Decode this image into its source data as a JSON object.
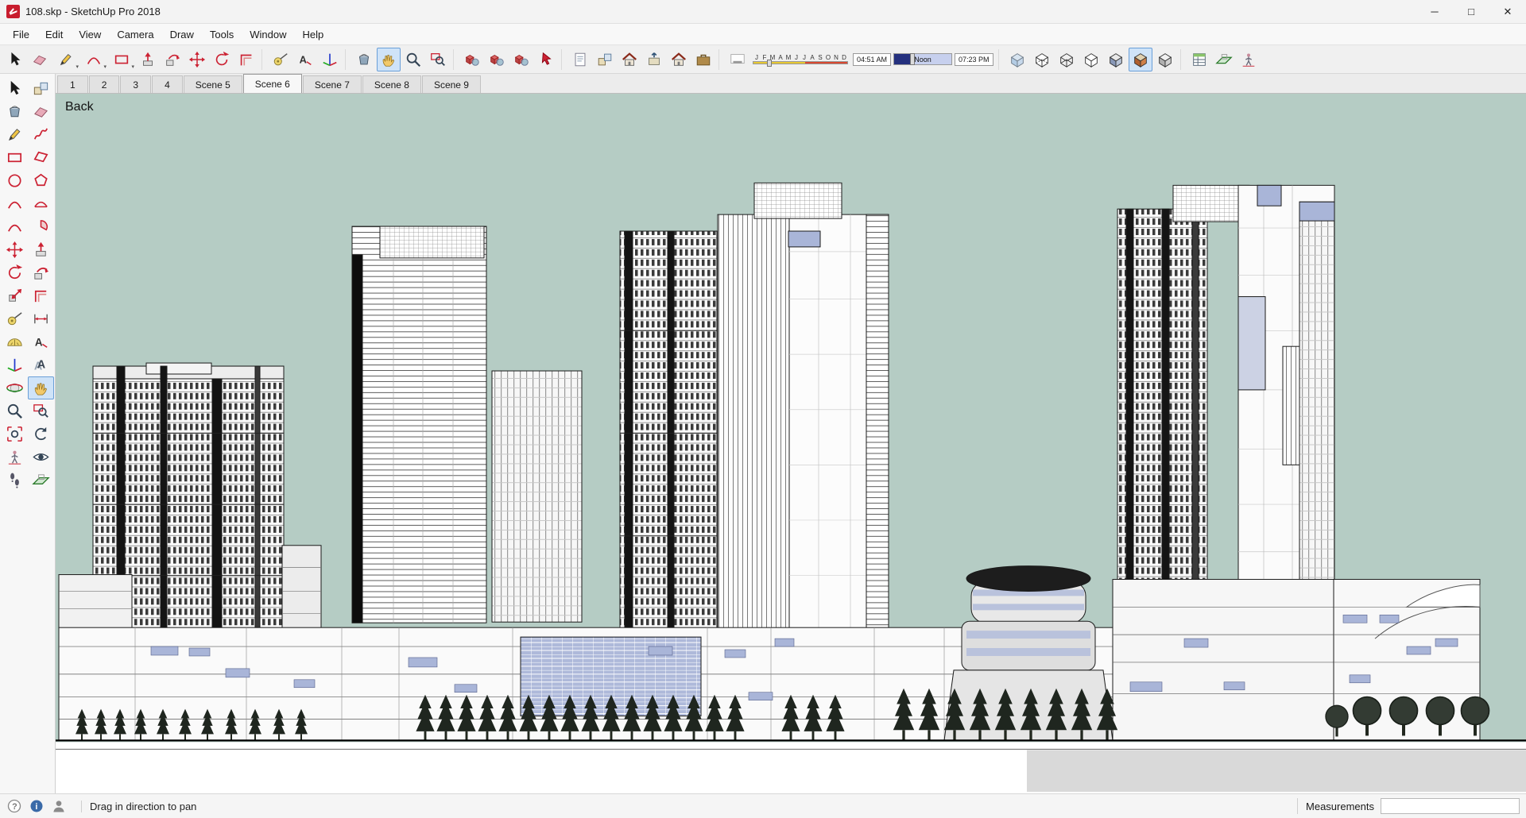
{
  "window": {
    "title": "108.skp - SketchUp Pro 2018",
    "controls": {
      "minimize": "─",
      "maximize": "□",
      "close": "✕"
    }
  },
  "menu": {
    "items": [
      "File",
      "Edit",
      "View",
      "Camera",
      "Draw",
      "Tools",
      "Window",
      "Help"
    ]
  },
  "toolbar": {
    "months": [
      "J",
      "F",
      "M",
      "A",
      "M",
      "J",
      "J",
      "A",
      "S",
      "O",
      "N",
      "D"
    ],
    "time_from": "04:51 AM",
    "time_noon": "Noon",
    "time_to": "07:23 PM"
  },
  "scene_tabs": {
    "items": [
      "1",
      "2",
      "3",
      "4",
      "Scene 5",
      "Scene 6",
      "Scene 7",
      "Scene 8",
      "Scene 9"
    ],
    "active": "Scene 6"
  },
  "canvas": {
    "back_label": "Back",
    "background": "#b5ccc4"
  },
  "status": {
    "hint": "Drag in direction to pan",
    "measurements_label": "Measurements",
    "measurements_value": ""
  }
}
